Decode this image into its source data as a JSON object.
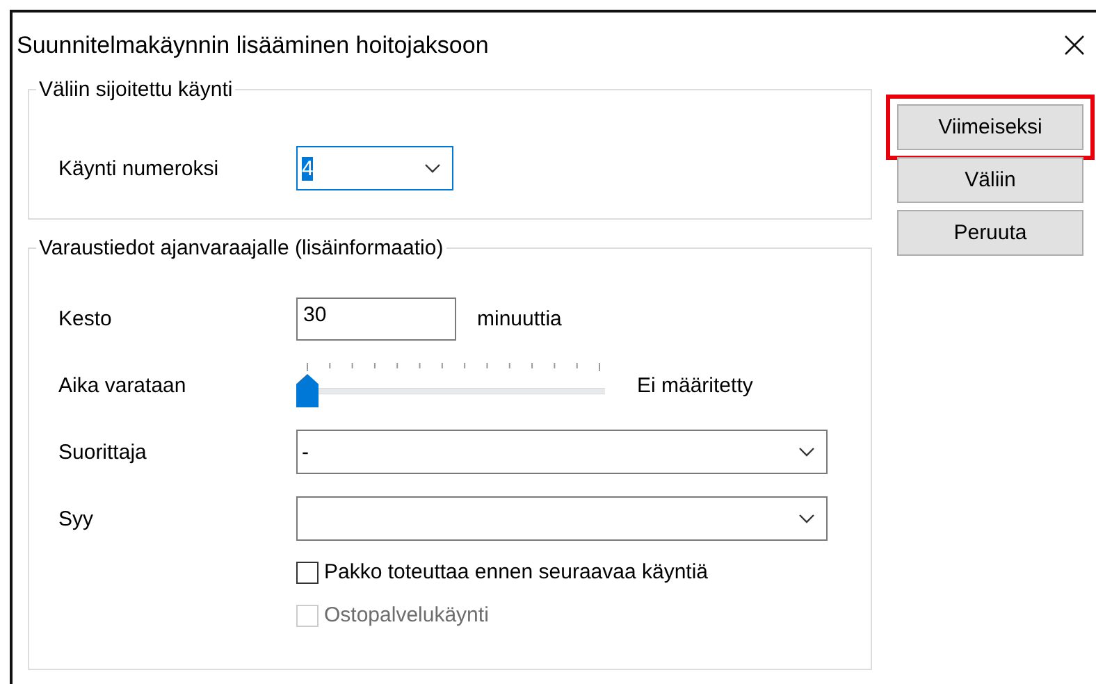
{
  "window": {
    "title": "Suunnitelmakäynnin lisääminen hoitojaksoon"
  },
  "groups": [
    {
      "legend": "Väliin sijoitettu käynti",
      "fields": [
        {
          "kind": "combo",
          "label": "Käynti numeroksi",
          "value": "4",
          "focused": true
        }
      ]
    },
    {
      "legend": "Varaustiedot ajanvaraajalle (lisäinformaatio)",
      "fields": [
        {
          "kind": "text",
          "label": "Kesto",
          "value": "30",
          "unit": "minuuttia"
        },
        {
          "kind": "slider",
          "label": "Aika varataan",
          "level": 0,
          "reading": "Ei määritetty"
        },
        {
          "kind": "combo",
          "label": "Suorittaja",
          "value": "-",
          "focused": false
        },
        {
          "kind": "combo",
          "label": "Syy",
          "focused": false
        },
        {
          "kind": "checkbox",
          "label": "Pakko toteuttaa ennen seuraavaa käyntiä",
          "checked": false,
          "disabled": false
        },
        {
          "kind": "checkbox",
          "label": "Ostopalvelukäynti",
          "checked": false,
          "disabled": true
        }
      ]
    }
  ],
  "buttons": [
    {
      "label": "Viimeiseksi",
      "highlighted": true
    },
    {
      "label": "Väliin",
      "highlighted": false
    },
    {
      "label": "Peruuta",
      "highlighted": false
    }
  ]
}
